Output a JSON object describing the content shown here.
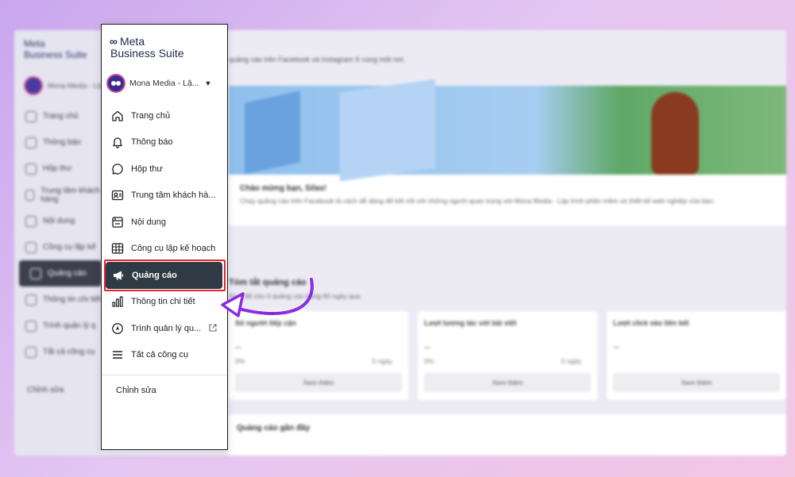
{
  "background": {
    "logo_line1": "Meta",
    "logo_line2": "Business Suite",
    "account_name": "Mona Media - Lậ",
    "nav": [
      "Trang chủ",
      "Thông báo",
      "Hộp thư",
      "Trung tâm khách hàng",
      "Nội dung",
      "Công cụ lập kế",
      "Quảng cáo",
      "Thông tin chi tiết",
      "Trình quản lý q",
      "Tất cả công cụ"
    ],
    "edit": "Chỉnh sửa",
    "subtitle": "quảng cáo trên Facebook và Instagram ở cùng một nơi.",
    "hero_title": "Chào mừng bạn, Silas!",
    "hero_text": "Chạy quảng cáo trên Facebook là cách dễ dàng để kết nối với những người quan trọng với Mona Media - Lập trình phần mềm và thiết kế web nghiệp của bạn.",
    "summary_title": "Tóm tắt quảng cáo",
    "summary_sub": "Xem để cho 0 quảng cáo trong 60 ngày qua.",
    "cards": [
      {
        "title": "Số người tiếp cận",
        "value": "--",
        "pct": "0%",
        "days": "0 ngày",
        "button": "Xem thêm"
      },
      {
        "title": "Lượt tương tác với bài viết",
        "value": "--",
        "pct": "0%",
        "days": "0 ngày",
        "button": "Xem thêm"
      },
      {
        "title": "Lượt click vào liên kết",
        "value": "--",
        "pct": "",
        "days": "",
        "button": "Xem thêm"
      }
    ],
    "recent_title": "Quảng cáo gần đây"
  },
  "sidebar": {
    "logo_mark": "∞",
    "logo_line1": "Meta",
    "logo_line2": "Business Suite",
    "account_name": "Mona Media - Lậ...",
    "account_caret": "▼",
    "items": [
      {
        "label": "Trang chủ",
        "icon": "home-icon"
      },
      {
        "label": "Thông báo",
        "icon": "bell-icon"
      },
      {
        "label": "Hộp thư",
        "icon": "chat-bubble-icon"
      },
      {
        "label": "Trung tâm khách hà...",
        "icon": "contacts-icon"
      },
      {
        "label": "Nội dung",
        "icon": "content-icon"
      },
      {
        "label": "Công cụ lập kế hoạch",
        "icon": "calendar-grid-icon"
      },
      {
        "label": "Quảng cáo",
        "icon": "megaphone-icon",
        "active": true
      },
      {
        "label": "Thông tin chi tiết",
        "icon": "bar-chart-icon"
      },
      {
        "label": "Trình quản lý qu...",
        "icon": "compass-icon",
        "external": true
      },
      {
        "label": "Tất cả công cụ",
        "icon": "menu-icon"
      }
    ],
    "edit_label": "Chỉnh sửa"
  },
  "colors": {
    "active_bg": "#2f3a44",
    "highlight": "#e3242b",
    "arrow": "#8a2be2",
    "avatar_bg": "#3b2d8f",
    "avatar_ring": "#d44f9a"
  }
}
